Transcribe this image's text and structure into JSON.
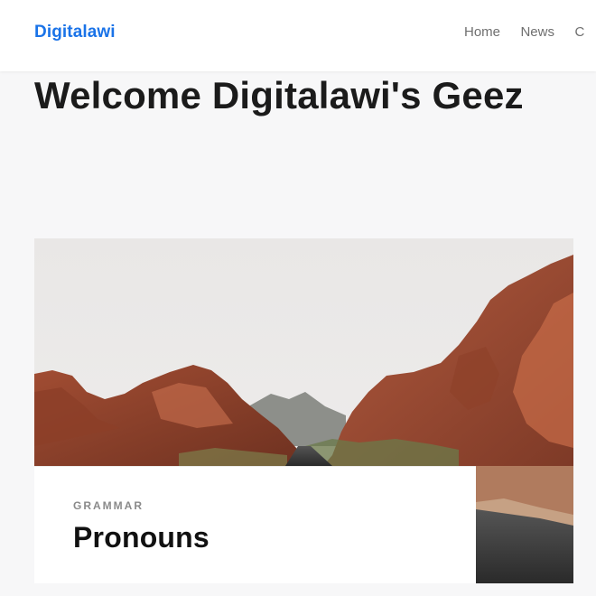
{
  "header": {
    "brand": "Digitalawi",
    "nav": [
      {
        "label": "Home"
      },
      {
        "label": "News"
      },
      {
        "label": "C"
      }
    ]
  },
  "main": {
    "title": "Welcome Digitalawi's Geez",
    "card": {
      "category": "GRAMMAR",
      "title": "Pronouns",
      "image": "desert-canyon-road-photo"
    }
  },
  "colors": {
    "brand": "#1a73e8",
    "nav_text": "#6f6f6f",
    "title_text": "#1b1b1b",
    "page_background": "#f7f7f8"
  }
}
